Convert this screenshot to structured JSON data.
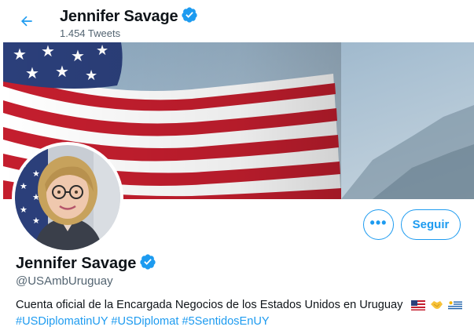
{
  "header": {
    "name": "Jennifer Savage",
    "tweet_count": "1.454 Tweets"
  },
  "banner": {
    "description": "us-flag-banner"
  },
  "actions": {
    "more_label": "•••",
    "follow_label": "Seguir"
  },
  "profile": {
    "name": "Jennifer Savage",
    "handle": "@USAmbUruguay",
    "bio": "Cuenta oficial de la Encargada Negocios de los Estados Unidos en Uruguay",
    "bio_emojis": [
      "us-flag-icon",
      "handshake-icon",
      "uruguay-flag-icon"
    ],
    "hashtags": [
      "#USDiplomatinUY",
      "#USDiplomat",
      "#5SentidosEnUY"
    ]
  },
  "colors": {
    "accent": "#1d9bf0",
    "text": "#0f1419",
    "secondary_text": "#536471"
  }
}
